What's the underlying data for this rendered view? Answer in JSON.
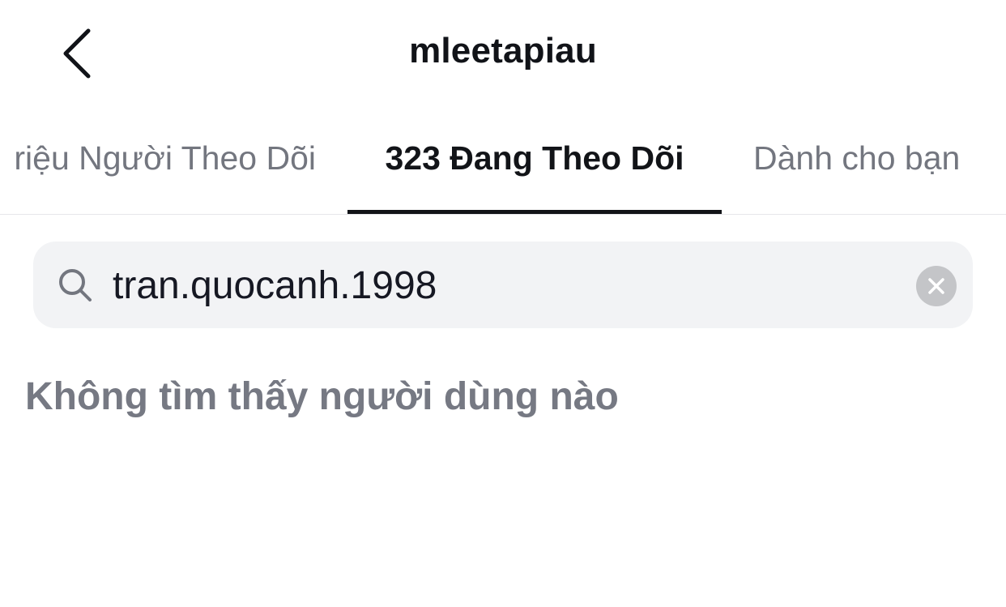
{
  "header": {
    "back_icon": "chevron-left-icon",
    "title": "mleetapiau"
  },
  "tabs": [
    {
      "label": "riệu Người Theo Dõi",
      "active": false
    },
    {
      "label": "323 Đang Theo Dõi",
      "active": true
    },
    {
      "label": "Dành cho bạn",
      "active": false
    }
  ],
  "search": {
    "icon": "search-icon",
    "value": "tran.quocanh.1998",
    "clear_icon": "close-icon"
  },
  "results": {
    "empty_message": "Không tìm thấy người dùng nào"
  },
  "colors": {
    "active_tab": "#121418",
    "inactive_tab": "#73767f",
    "search_background": "#f2f3f5",
    "clear_button": "#c4c5c8",
    "empty_text": "#767983"
  }
}
